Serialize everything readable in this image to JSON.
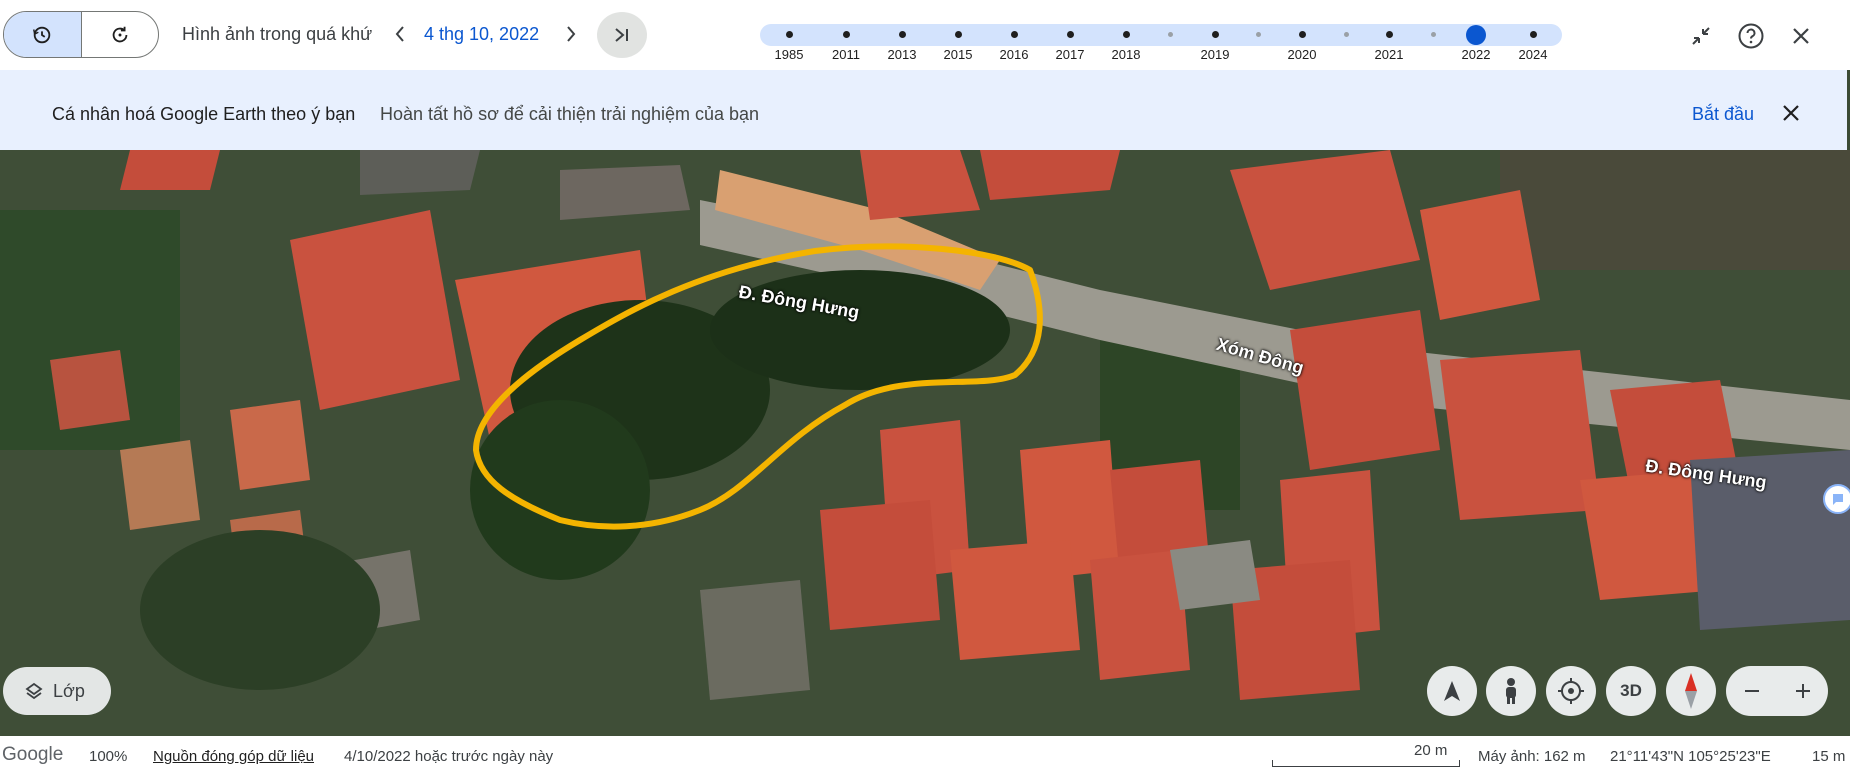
{
  "toolbar": {
    "title": "Hình ảnh trong quá khứ",
    "date": "4 thg 10, 2022",
    "icons": [
      "history-icon",
      "refresh-icon",
      "chevron-left-icon",
      "chevron-right-icon",
      "skip-to-latest-icon",
      "collapse-icon",
      "help-icon",
      "close-icon"
    ]
  },
  "timeline": {
    "years": [
      "1985",
      "2011",
      "2013",
      "2015",
      "2016",
      "2017",
      "2018",
      "2019",
      "2020",
      "2021",
      "2022",
      "2024"
    ],
    "selected_year": "2022"
  },
  "banner": {
    "title": "Cá nhân hoá Google Earth theo ý bạn",
    "subtitle": "Hoàn tất hồ sơ để cải thiện trải nghiệm của bạn",
    "start_label": "Bắt đầu"
  },
  "map": {
    "road_labels": [
      "Đ. Đông Hưng",
      "Xóm Đông",
      "Đ. Đông Hưng"
    ],
    "outline_color": "#f4b400"
  },
  "controls": {
    "layers_label": "Lớp",
    "view_3d_label": "3D"
  },
  "status": {
    "brand": "Google",
    "zoom": "100%",
    "data_link": "Nguồn đóng góp dữ liệu",
    "imagery_date": "4/10/2022 hoặc trước ngày này",
    "scale": "20 m",
    "camera": "Máy ảnh: 162 m",
    "coords": "21°11'43\"N 105°25'23\"E",
    "elevation": "15 m"
  }
}
